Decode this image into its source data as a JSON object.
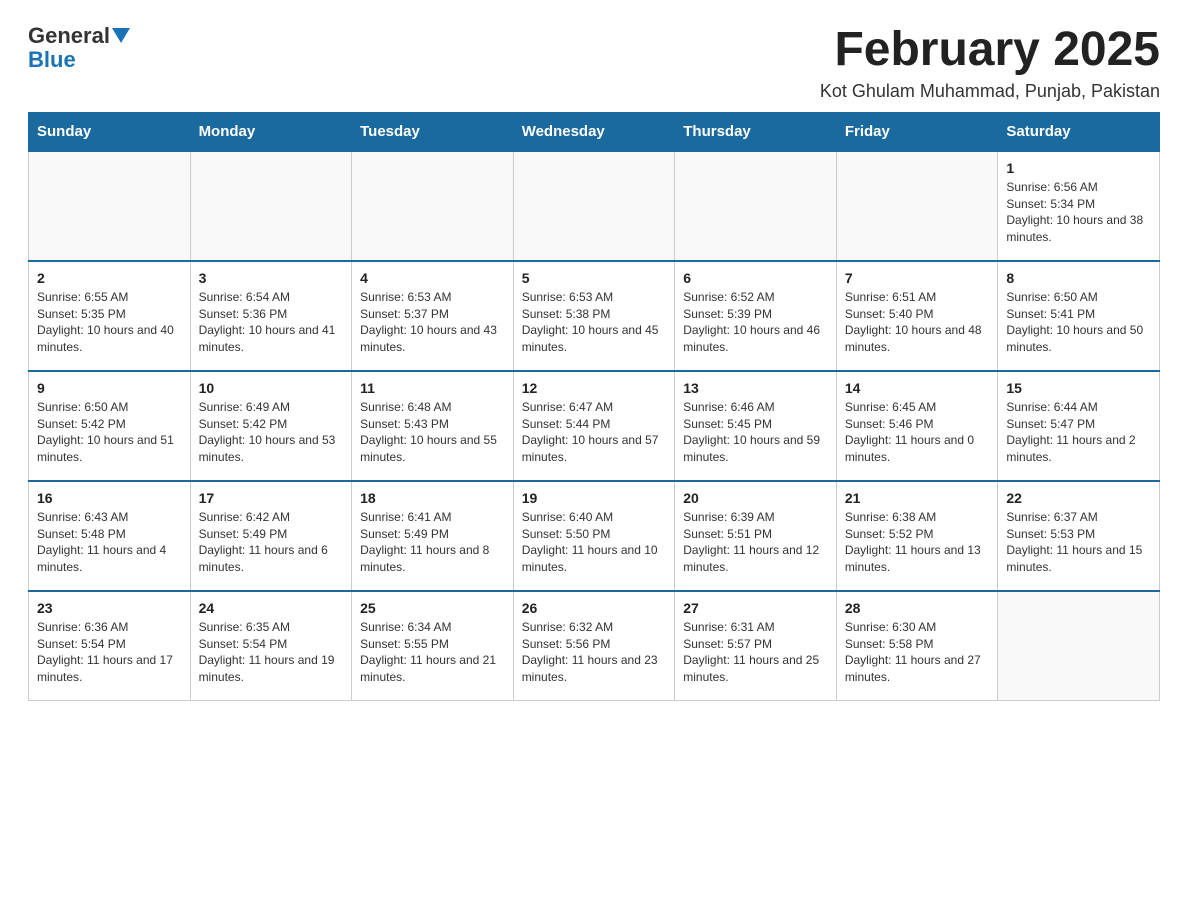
{
  "logo": {
    "general": "General",
    "blue": "Blue"
  },
  "header": {
    "month_year": "February 2025",
    "location": "Kot Ghulam Muhammad, Punjab, Pakistan"
  },
  "weekdays": [
    "Sunday",
    "Monday",
    "Tuesday",
    "Wednesday",
    "Thursday",
    "Friday",
    "Saturday"
  ],
  "weeks": [
    [
      {
        "day": "",
        "info": ""
      },
      {
        "day": "",
        "info": ""
      },
      {
        "day": "",
        "info": ""
      },
      {
        "day": "",
        "info": ""
      },
      {
        "day": "",
        "info": ""
      },
      {
        "day": "",
        "info": ""
      },
      {
        "day": "1",
        "info": "Sunrise: 6:56 AM\nSunset: 5:34 PM\nDaylight: 10 hours and 38 minutes."
      }
    ],
    [
      {
        "day": "2",
        "info": "Sunrise: 6:55 AM\nSunset: 5:35 PM\nDaylight: 10 hours and 40 minutes."
      },
      {
        "day": "3",
        "info": "Sunrise: 6:54 AM\nSunset: 5:36 PM\nDaylight: 10 hours and 41 minutes."
      },
      {
        "day": "4",
        "info": "Sunrise: 6:53 AM\nSunset: 5:37 PM\nDaylight: 10 hours and 43 minutes."
      },
      {
        "day": "5",
        "info": "Sunrise: 6:53 AM\nSunset: 5:38 PM\nDaylight: 10 hours and 45 minutes."
      },
      {
        "day": "6",
        "info": "Sunrise: 6:52 AM\nSunset: 5:39 PM\nDaylight: 10 hours and 46 minutes."
      },
      {
        "day": "7",
        "info": "Sunrise: 6:51 AM\nSunset: 5:40 PM\nDaylight: 10 hours and 48 minutes."
      },
      {
        "day": "8",
        "info": "Sunrise: 6:50 AM\nSunset: 5:41 PM\nDaylight: 10 hours and 50 minutes."
      }
    ],
    [
      {
        "day": "9",
        "info": "Sunrise: 6:50 AM\nSunset: 5:42 PM\nDaylight: 10 hours and 51 minutes."
      },
      {
        "day": "10",
        "info": "Sunrise: 6:49 AM\nSunset: 5:42 PM\nDaylight: 10 hours and 53 minutes."
      },
      {
        "day": "11",
        "info": "Sunrise: 6:48 AM\nSunset: 5:43 PM\nDaylight: 10 hours and 55 minutes."
      },
      {
        "day": "12",
        "info": "Sunrise: 6:47 AM\nSunset: 5:44 PM\nDaylight: 10 hours and 57 minutes."
      },
      {
        "day": "13",
        "info": "Sunrise: 6:46 AM\nSunset: 5:45 PM\nDaylight: 10 hours and 59 minutes."
      },
      {
        "day": "14",
        "info": "Sunrise: 6:45 AM\nSunset: 5:46 PM\nDaylight: 11 hours and 0 minutes."
      },
      {
        "day": "15",
        "info": "Sunrise: 6:44 AM\nSunset: 5:47 PM\nDaylight: 11 hours and 2 minutes."
      }
    ],
    [
      {
        "day": "16",
        "info": "Sunrise: 6:43 AM\nSunset: 5:48 PM\nDaylight: 11 hours and 4 minutes."
      },
      {
        "day": "17",
        "info": "Sunrise: 6:42 AM\nSunset: 5:49 PM\nDaylight: 11 hours and 6 minutes."
      },
      {
        "day": "18",
        "info": "Sunrise: 6:41 AM\nSunset: 5:49 PM\nDaylight: 11 hours and 8 minutes."
      },
      {
        "day": "19",
        "info": "Sunrise: 6:40 AM\nSunset: 5:50 PM\nDaylight: 11 hours and 10 minutes."
      },
      {
        "day": "20",
        "info": "Sunrise: 6:39 AM\nSunset: 5:51 PM\nDaylight: 11 hours and 12 minutes."
      },
      {
        "day": "21",
        "info": "Sunrise: 6:38 AM\nSunset: 5:52 PM\nDaylight: 11 hours and 13 minutes."
      },
      {
        "day": "22",
        "info": "Sunrise: 6:37 AM\nSunset: 5:53 PM\nDaylight: 11 hours and 15 minutes."
      }
    ],
    [
      {
        "day": "23",
        "info": "Sunrise: 6:36 AM\nSunset: 5:54 PM\nDaylight: 11 hours and 17 minutes."
      },
      {
        "day": "24",
        "info": "Sunrise: 6:35 AM\nSunset: 5:54 PM\nDaylight: 11 hours and 19 minutes."
      },
      {
        "day": "25",
        "info": "Sunrise: 6:34 AM\nSunset: 5:55 PM\nDaylight: 11 hours and 21 minutes."
      },
      {
        "day": "26",
        "info": "Sunrise: 6:32 AM\nSunset: 5:56 PM\nDaylight: 11 hours and 23 minutes."
      },
      {
        "day": "27",
        "info": "Sunrise: 6:31 AM\nSunset: 5:57 PM\nDaylight: 11 hours and 25 minutes."
      },
      {
        "day": "28",
        "info": "Sunrise: 6:30 AM\nSunset: 5:58 PM\nDaylight: 11 hours and 27 minutes."
      },
      {
        "day": "",
        "info": ""
      }
    ]
  ]
}
